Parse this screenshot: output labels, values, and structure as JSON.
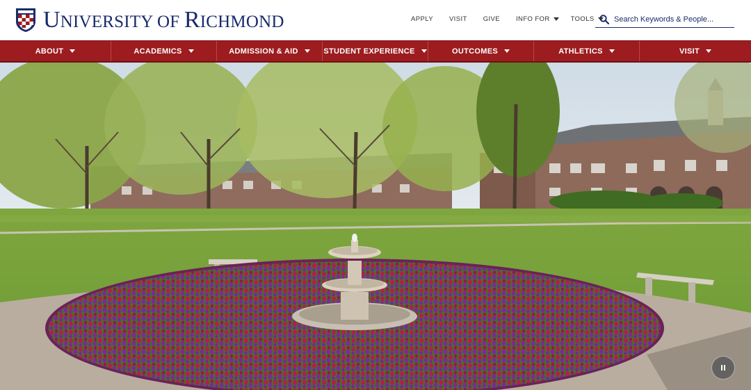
{
  "brand": {
    "name_parts": [
      "U",
      "NIVERSITY OF ",
      "R",
      "ICHMOND"
    ],
    "shield_colors": {
      "navy": "#1a2b6b",
      "red": "#9c1c1f"
    }
  },
  "utility_nav": {
    "links": [
      "APPLY",
      "VISIT",
      "GIVE"
    ],
    "dropdowns": [
      "INFO FOR",
      "TOOLS"
    ]
  },
  "search": {
    "placeholder": "Search Keywords & People...",
    "icon": "search-icon"
  },
  "main_nav": {
    "items": [
      "ABOUT",
      "ACADEMICS",
      "ADMISSION & AID",
      "STUDENT EXPERIENCE",
      "OUTCOMES",
      "ATHLETICS",
      "VISIT"
    ]
  },
  "hero": {
    "control": "pause-icon"
  },
  "colors": {
    "nav_background": "#9c1c1f",
    "brand_navy": "#1a2b6b"
  }
}
